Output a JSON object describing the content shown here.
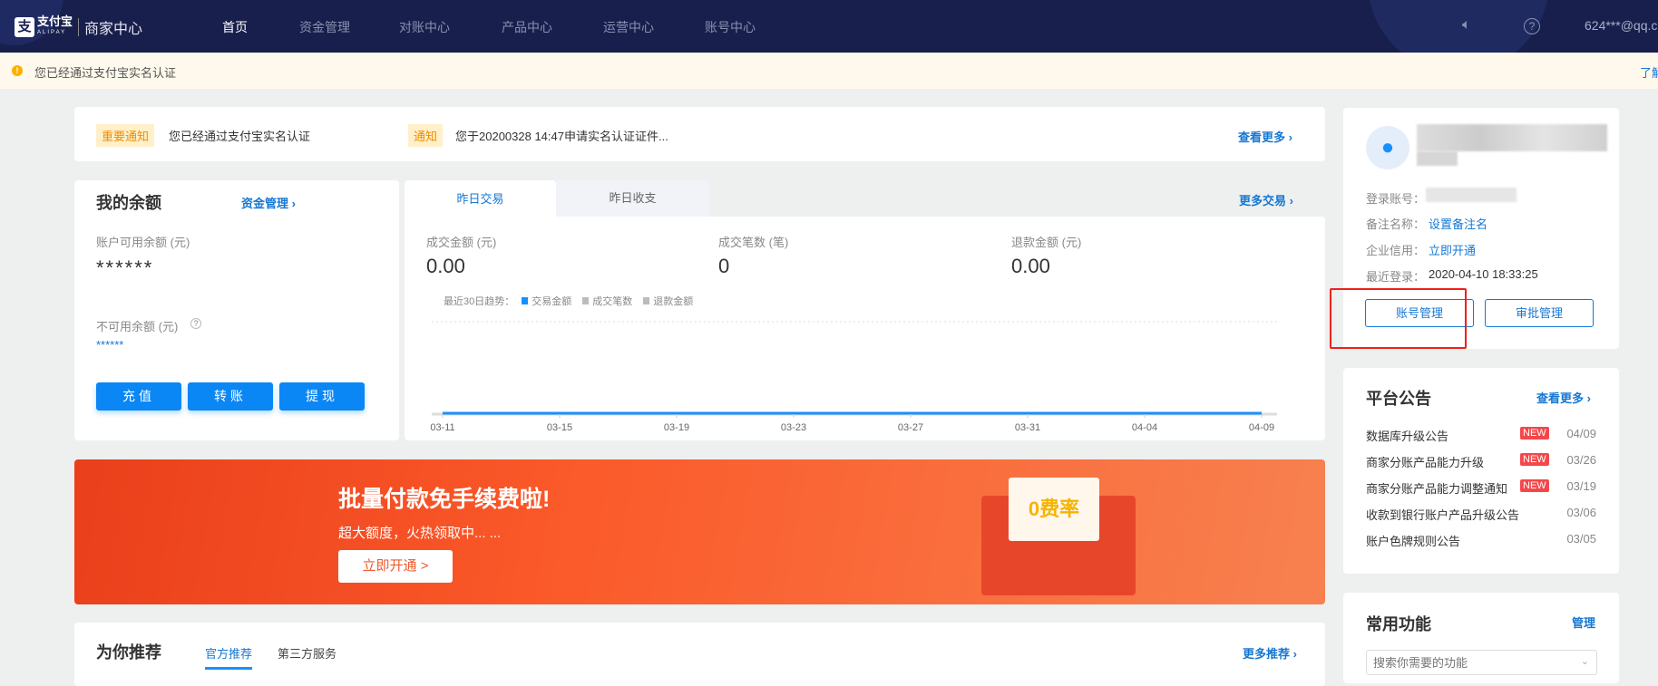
{
  "nav": {
    "logo_cn": "支付宝",
    "logo_en": "ALIPAY",
    "title": "商家中心",
    "items": [
      "首页",
      "资金管理",
      "对账中心",
      "产品中心",
      "运营中心",
      "账号中心"
    ],
    "user": "624***@qq.c"
  },
  "notice_bar": {
    "text": "您已经通过支付宝实名认证",
    "link": "了解"
  },
  "notices": {
    "tag1": "重要通知",
    "text1": "您已经通过支付宝实名认证",
    "tag2": "通知",
    "text2": "您于20200328 14:47申请实名认证证件...",
    "more": "查看更多 ›"
  },
  "balance": {
    "title": "我的余额",
    "manage": "资金管理 ›",
    "available_label": "账户可用余额 (元)",
    "available_value": "******",
    "unavailable_label": "不可用余额 (元)",
    "unavailable_value": "******",
    "buttons": [
      "充值",
      "转账",
      "提现"
    ]
  },
  "trade": {
    "tabs": [
      "昨日交易",
      "昨日收支"
    ],
    "more": "更多交易 ›",
    "stats": [
      {
        "label": "成交金额 (元)",
        "value": "0.00"
      },
      {
        "label": "成交笔数 (笔)",
        "value": "0"
      },
      {
        "label": "退款金额 (元)",
        "value": "0.00"
      }
    ],
    "legend_title": "最近30日趋势：",
    "legend": [
      "交易金额",
      "成交笔数",
      "退款金额"
    ]
  },
  "chart_data": {
    "type": "line",
    "categories": [
      "03-11",
      "03-15",
      "03-19",
      "03-23",
      "03-27",
      "03-31",
      "04-04",
      "04-09"
    ],
    "series": [
      {
        "name": "交易金额",
        "values": [
          0,
          0,
          0,
          0,
          0,
          0,
          0,
          0
        ],
        "color": "#1890ff"
      }
    ]
  },
  "banner": {
    "title": "批量付款免手续费啦!",
    "subtitle": "超大额度，火热领取中... ...",
    "button": "立即开通 >",
    "badge": "0费率"
  },
  "recommend": {
    "title": "为你推荐",
    "tabs": [
      "官方推荐",
      "第三方服务"
    ],
    "more": "更多推荐 ›"
  },
  "profile": {
    "login_label": "登录账号：",
    "remark_label": "备注名称：",
    "remark_link": "设置备注名",
    "credit_label": "企业信用：",
    "credit_link": "立即开通",
    "last_login_label": "最近登录：",
    "last_login": "2020-04-10 18:33:25",
    "buttons": [
      "账号管理",
      "审批管理"
    ]
  },
  "announcements": {
    "title": "平台公告",
    "more": "查看更多 ›",
    "new": "NEW",
    "items": [
      {
        "title": "数据库升级公告",
        "date": "04/09",
        "is_new": true
      },
      {
        "title": "商家分账产品能力升级",
        "date": "03/26",
        "is_new": true
      },
      {
        "title": "商家分账产品能力调整通知",
        "date": "03/19",
        "is_new": true
      },
      {
        "title": "收款到银行账户产品升级公告",
        "date": "03/06",
        "is_new": false
      },
      {
        "title": "账户色牌规则公告",
        "date": "03/05",
        "is_new": false
      }
    ]
  },
  "common": {
    "title": "常用功能",
    "manage": "管理",
    "search_placeholder": "搜索你需要的功能"
  }
}
